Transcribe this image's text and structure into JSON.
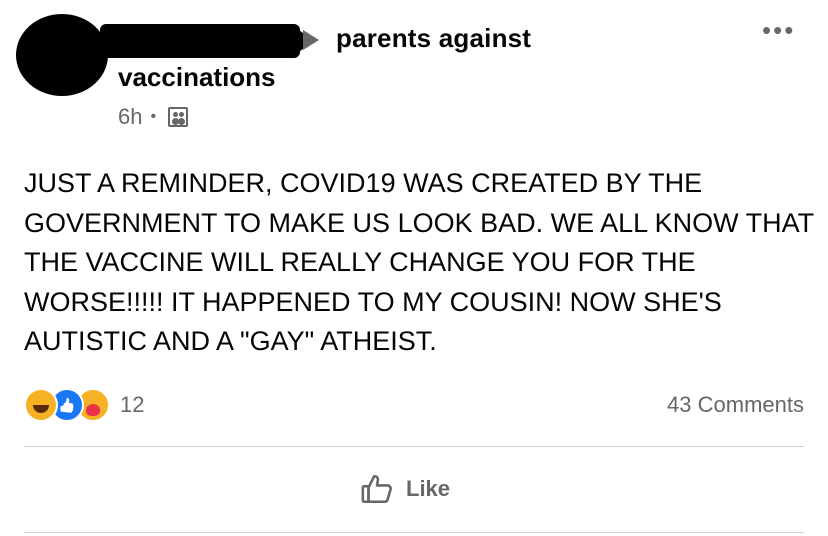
{
  "header": {
    "group_name_line1": "parents against",
    "group_name_line2": "vaccinations",
    "time": "6h",
    "separator": "•",
    "privacy_icon": "members-icon",
    "more_label": "•••"
  },
  "post": {
    "text": "JUST A REMINDER, COVID19 WAS CREATED BY THE GOVERNMENT TO MAKE US LOOK BAD. WE ALL KNOW THAT THE VACCINE WILL REALLY CHANGE YOU FOR THE WORSE!!!!! IT HAPPENED TO MY COUSIN! NOW SHE'S AUTISTIC AND A \"GAY\" ATHEIST."
  },
  "stats": {
    "reaction_icons": [
      "haha-icon",
      "like-icon",
      "care-icon"
    ],
    "reaction_count": "12",
    "comments": "43 Comments"
  },
  "actions": {
    "like_label": "Like"
  },
  "colors": {
    "text": "#050505",
    "secondary": "#65676b",
    "like_blue": "#1877f2",
    "reaction_yellow": "#f7b125"
  }
}
